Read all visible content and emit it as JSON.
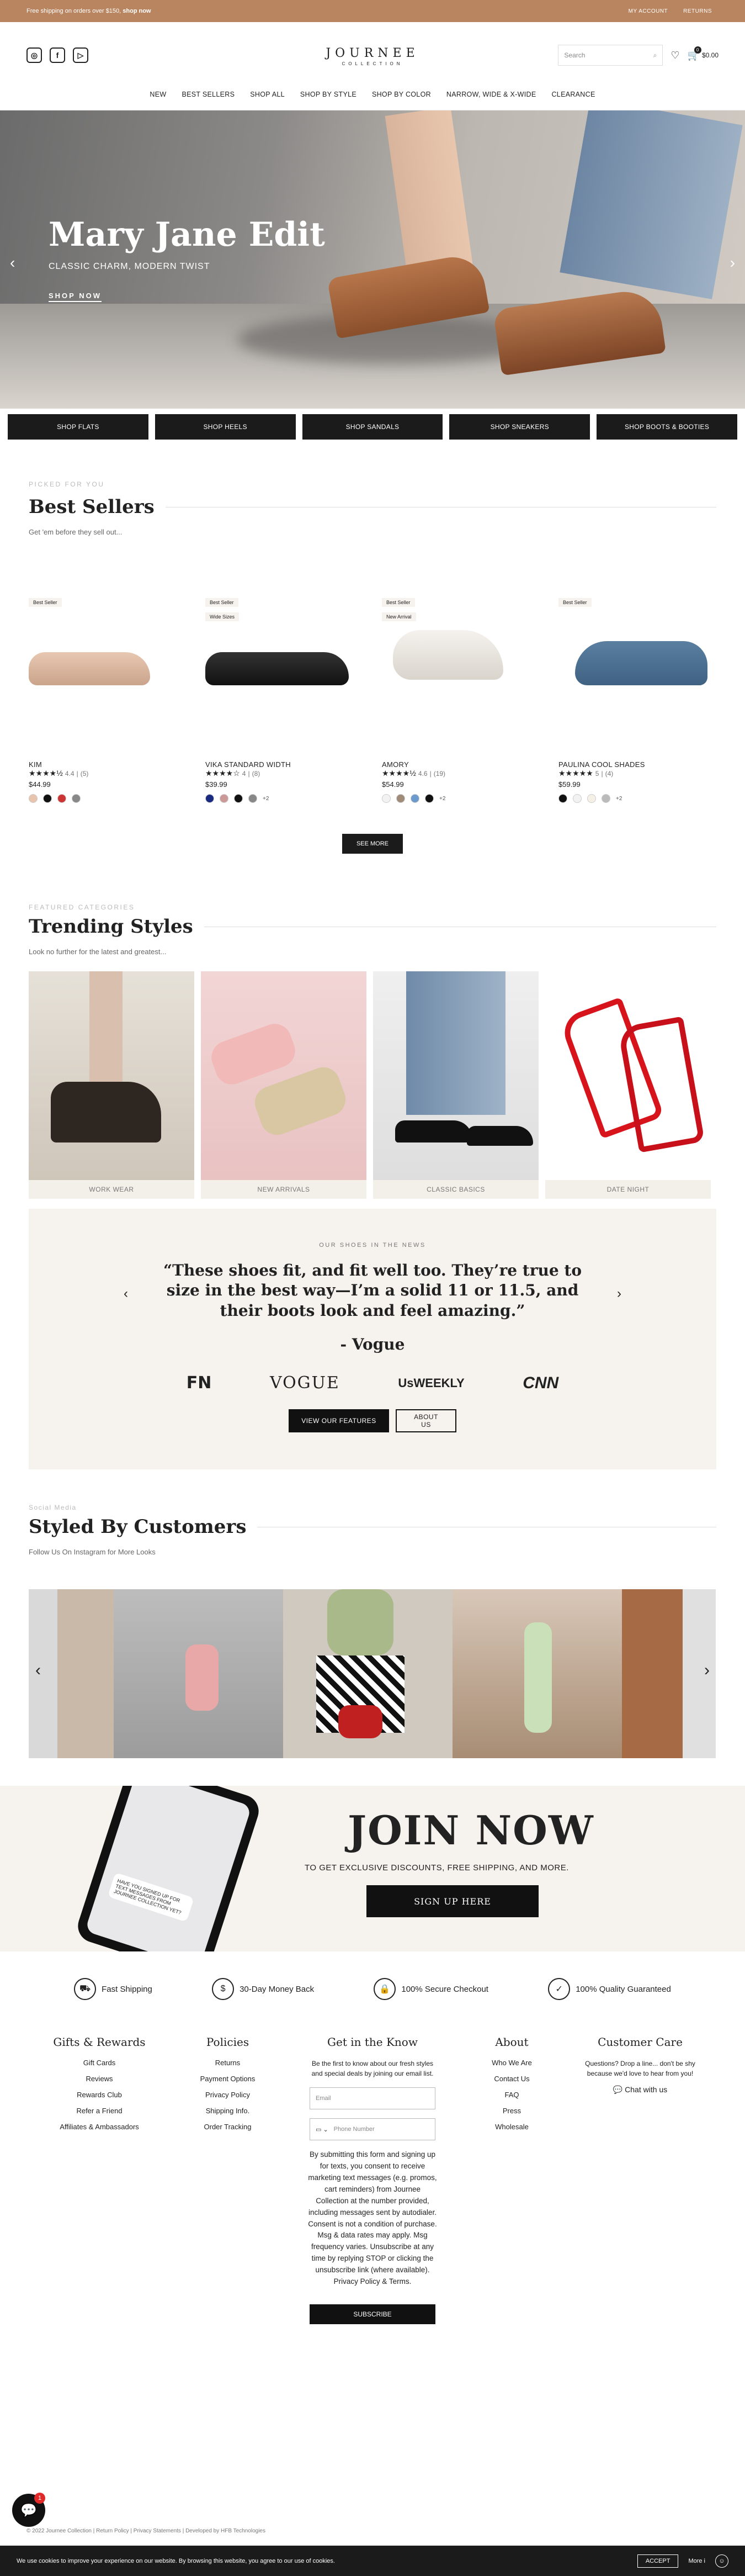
{
  "announcement": {
    "text": "Free shipping on orders over $150,",
    "link": "shop now",
    "account": "MY ACCOUNT",
    "returns": "RETURNS"
  },
  "header": {
    "logo_main": "JOURNEE",
    "logo_sub": "COLLECTION",
    "search_placeholder": "Search",
    "cart_total": "$0.00",
    "cart_count": "0",
    "nav": [
      "NEW",
      "BEST SELLERS",
      "SHOP ALL",
      "SHOP BY STYLE",
      "SHOP BY COLOR",
      "NARROW, WIDE & X-WIDE",
      "CLEARANCE"
    ]
  },
  "hero": {
    "title": "Mary Jane Edit",
    "subtitle": "CLASSIC CHARM, MODERN TWIST",
    "cta": "SHOP NOW"
  },
  "shop_buttons": [
    "SHOP FLATS",
    "SHOP HEELS",
    "SHOP SANDALS",
    "SHOP SNEAKERS",
    "SHOP BOOTS & BOOTIES"
  ],
  "best_sellers": {
    "eyebrow": "PICKED FOR YOU",
    "title": "Best Sellers",
    "subtitle": "Get 'em before they sell out...",
    "see_more": "SEE MORE",
    "products": [
      {
        "badges": [
          "Best Seller"
        ],
        "name": "KIM",
        "stars": "★★★★½",
        "rating": "4.4",
        "reviews": "(5)",
        "price": "$44.99",
        "swatches": [
          "#e9c4ad",
          "#111111",
          "#cc3333",
          "#888888"
        ],
        "more": ""
      },
      {
        "badges": [
          "Best Seller",
          "Wide Sizes"
        ],
        "name": "VIKA STANDARD WIDTH",
        "stars": "★★★★☆",
        "rating": "4",
        "reviews": "(8)",
        "price": "$39.99",
        "swatches": [
          "#1a2a80",
          "#c99",
          "#111111",
          "#888888"
        ],
        "more": "+2"
      },
      {
        "badges": [
          "Best Seller",
          "New Arrival"
        ],
        "name": "AMORY",
        "stars": "★★★★½",
        "rating": "4.6",
        "reviews": "(19)",
        "price": "$54.99",
        "swatches": [
          "#f2f2f2",
          "#a08a78",
          "#6b9bcc",
          "#111111"
        ],
        "more": "+2"
      },
      {
        "badges": [
          "Best Seller"
        ],
        "name": "PAULINA COOL SHADES",
        "stars": "★★★★★",
        "rating": "5",
        "reviews": "(4)",
        "price": "$59.99",
        "swatches": [
          "#111111",
          "#f2f2f2",
          "#f5f0e6",
          "#bbbbbb"
        ],
        "more": "+2"
      }
    ]
  },
  "trending": {
    "eyebrow": "FEATURED CATEGORIES",
    "title": "Trending Styles",
    "subtitle": "Look no further for the latest and greatest...",
    "cards": [
      "WORK WEAR",
      "NEW ARRIVALS",
      "CLASSIC BASICS",
      "DATE NIGHT"
    ]
  },
  "press": {
    "eyebrow": "OUR SHOES IN THE NEWS",
    "quote": "“These shoes fit, and fit well too. They’re true to size in the best way—I’m a solid 11 or 11.5, and their boots look and feel amazing.”",
    "author": "- Vogue",
    "logos": [
      "FN",
      "VOGUE",
      "UsWEEKLY",
      "CNN"
    ],
    "btn_features": "VIEW OUR FEATURES",
    "btn_about": "ABOUT US"
  },
  "social": {
    "eyebrow": "Social Media",
    "title": "Styled By Customers",
    "subtitle": "Follow Us On Instagram for More Looks"
  },
  "join": {
    "title": "JOIN NOW",
    "subtitle": "TO GET EXCLUSIVE DISCOUNTS, FREE SHIPPING, AND MORE.",
    "cta": "SIGN UP HERE",
    "phone_text": "HAVE YOU SIGNED UP FOR TEXT MESSAGES FROM JOURNEE COLLECTION YET?"
  },
  "perks": [
    {
      "icon": "truck-icon",
      "label": "Fast Shipping"
    },
    {
      "icon": "money-back-icon",
      "label": "30-Day Money Back"
    },
    {
      "icon": "secure-icon",
      "label": "100% Secure Checkout"
    },
    {
      "icon": "quality-icon",
      "label": "100% Quality Guaranteed"
    }
  ],
  "footer": {
    "gifts": {
      "title": "Gifts & Rewards",
      "items": [
        "Gift Cards",
        "Reviews",
        "Rewards Club",
        "Refer a Friend",
        "Affiliates & Ambassadors"
      ]
    },
    "policies": {
      "title": "Policies",
      "items": [
        "Returns",
        "Payment Options",
        "Privacy Policy",
        "Shipping Info.",
        "Order Tracking"
      ]
    },
    "know": {
      "title": "Get in the Know",
      "text": "Be the first to know about our fresh styles and special deals by joining our email list.",
      "email_placeholder": "Email",
      "phone_placeholder": "Phone Number",
      "legal": "By submitting this form and signing up for texts, you consent to receive marketing text messages (e.g. promos, cart reminders) from Journee Collection at the number provided, including messages sent by autodialer. Consent is not a condition of purchase. Msg & data rates may apply. Msg frequency varies. Unsubscribe at any time by replying STOP or clicking the unsubscribe link (where available). Privacy Policy & Terms.",
      "subscribe": "SUBSCRIBE"
    },
    "about": {
      "title": "About",
      "items": [
        "Who We Are",
        "Contact Us",
        "FAQ",
        "Press",
        "Wholesale"
      ]
    },
    "care": {
      "title": "Customer Care",
      "text": "Questions? Drop a line... don't be shy because we'd love to hear from you!",
      "chat": "Chat with us"
    },
    "copyright": "© 2022 Journee Collection | Return Policy | Privacy Statements | Developed by HFB Technologies"
  },
  "cookie": {
    "text": "We use cookies to improve your experience on our website. By browsing this website, you agree to our use of cookies.",
    "accept": "ACCEPT",
    "more": "More i"
  },
  "chat_badge": "1"
}
